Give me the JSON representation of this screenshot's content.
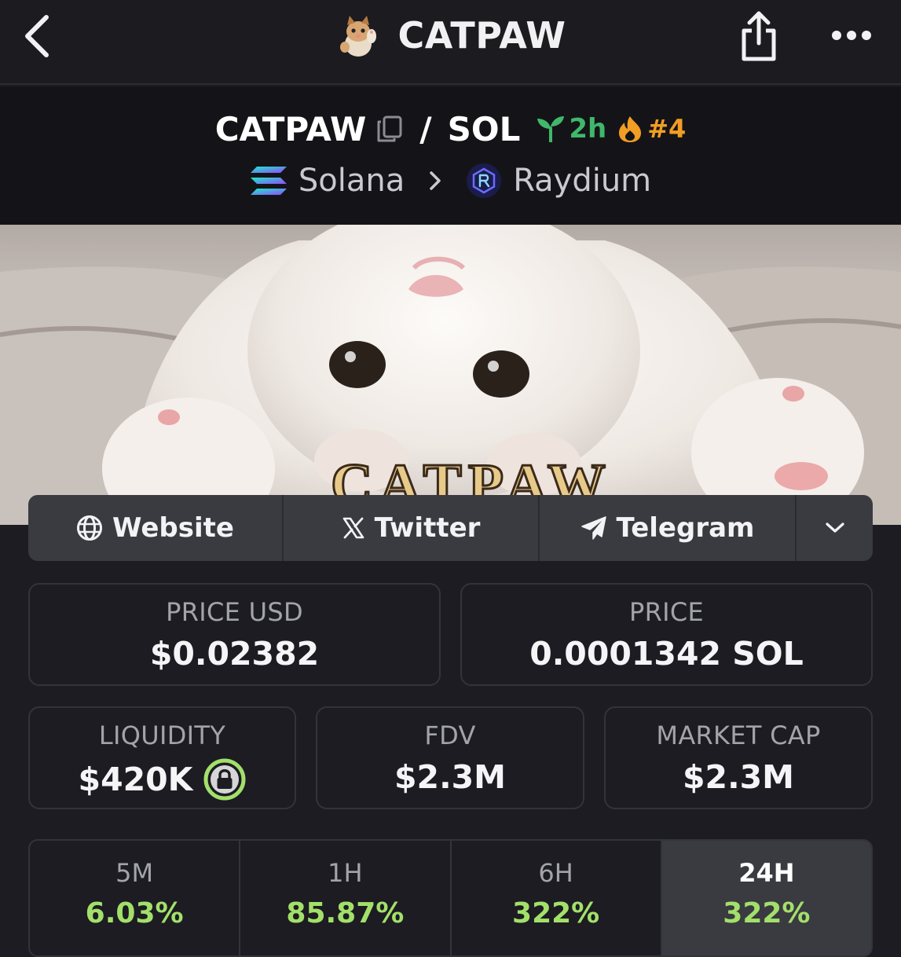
{
  "nav": {
    "title": "CATPAW",
    "back_icon": "chevron-left-icon",
    "share_icon": "share-icon",
    "more_icon": "more-dots-icon"
  },
  "pair": {
    "base": "CATPAW",
    "separator": "/",
    "quote": "SOL",
    "age": "2h",
    "rank": "#4",
    "chain": "Solana",
    "dex": "Raydium",
    "age_color": "#3fb86a",
    "rank_color": "#f29d24"
  },
  "banner": {
    "text": "CATPAW"
  },
  "links": {
    "website": "Website",
    "twitter": "Twitter",
    "telegram": "Telegram"
  },
  "stats": {
    "price_usd_label": "PRICE USD",
    "price_usd_value": "$0.02382",
    "price_label": "PRICE",
    "price_value": "0.0001342 SOL",
    "liquidity_label": "LIQUIDITY",
    "liquidity_value": "$420K",
    "fdv_label": "FDV",
    "fdv_value": "$2.3M",
    "mcap_label": "MARKET CAP",
    "mcap_value": "$2.3M"
  },
  "timeframes": [
    {
      "label": "5M",
      "value": "6.03%"
    },
    {
      "label": "1H",
      "value": "85.87%"
    },
    {
      "label": "6H",
      "value": "322%"
    },
    {
      "label": "24H",
      "value": "322%",
      "selected": true
    }
  ],
  "colors": {
    "background": "#1c1c22",
    "positive": "#a3e06a",
    "lock_badge": "#a3e06a"
  }
}
